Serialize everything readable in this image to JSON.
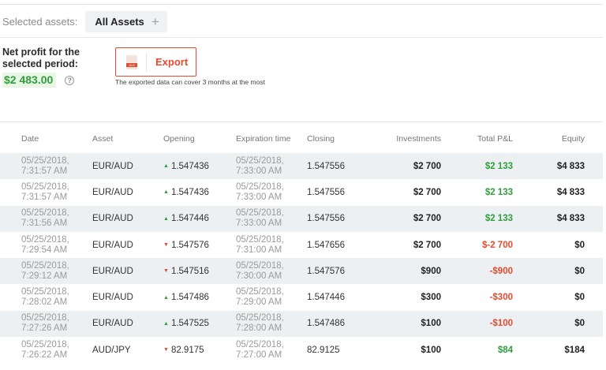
{
  "filter": {
    "label": "Selected assets:",
    "chip_label": "All Assets",
    "chip_plus": "+"
  },
  "profit": {
    "label": "Net profit for the selected period:",
    "value": "$2 483.00",
    "info_glyph": "?"
  },
  "export": {
    "label": "Export",
    "icon_text": "XLS",
    "note": "The exported data can cover 3 months at the most"
  },
  "colors": {
    "positive": "#2f9e3c",
    "negative": "#e44a2d",
    "accent": "#e44a2d"
  },
  "table": {
    "headers": {
      "date": "Date",
      "asset": "Asset",
      "opening": "Opening",
      "expiration": "Expiration time",
      "closing": "Closing",
      "investments": "Investments",
      "pnl": "Total P&L",
      "equity": "Equity"
    },
    "rows": [
      {
        "date": "05/25/2018,\n7:31:57 AM",
        "asset": "EUR/AUD",
        "dir": "up",
        "opening": "1.547436",
        "expiration": "05/25/2018,\n7:33:00 AM",
        "closing": "1.547556",
        "investments": "$2 700",
        "pnl": "$2 133",
        "pnl_sign": "pos",
        "equity": "$4 833"
      },
      {
        "date": "05/25/2018,\n7:31:57 AM",
        "asset": "EUR/AUD",
        "dir": "up",
        "opening": "1.547436",
        "expiration": "05/25/2018,\n7:33:00 AM",
        "closing": "1.547556",
        "investments": "$2 700",
        "pnl": "$2 133",
        "pnl_sign": "pos",
        "equity": "$4 833"
      },
      {
        "date": "05/25/2018,\n7:31:56 AM",
        "asset": "EUR/AUD",
        "dir": "up",
        "opening": "1.547446",
        "expiration": "05/25/2018,\n7:33:00 AM",
        "closing": "1.547556",
        "investments": "$2 700",
        "pnl": "$2 133",
        "pnl_sign": "pos",
        "equity": "$4 833"
      },
      {
        "date": "05/25/2018,\n7:29:54 AM",
        "asset": "EUR/AUD",
        "dir": "down",
        "opening": "1.547576",
        "expiration": "05/25/2018,\n7:31:00 AM",
        "closing": "1.547656",
        "investments": "$2 700",
        "pnl": "$-2 700",
        "pnl_sign": "neg",
        "equity": "$0"
      },
      {
        "date": "05/25/2018,\n7:29:12 AM",
        "asset": "EUR/AUD",
        "dir": "down",
        "opening": "1.547516",
        "expiration": "05/25/2018,\n7:30:00 AM",
        "closing": "1.547576",
        "investments": "$900",
        "pnl": "-$900",
        "pnl_sign": "neg",
        "equity": "$0"
      },
      {
        "date": "05/25/2018,\n7:28:02 AM",
        "asset": "EUR/AUD",
        "dir": "up",
        "opening": "1.547486",
        "expiration": "05/25/2018,\n7:29:00 AM",
        "closing": "1.547446",
        "investments": "$300",
        "pnl": "-$300",
        "pnl_sign": "neg",
        "equity": "$0"
      },
      {
        "date": "05/25/2018,\n7:27:26 AM",
        "asset": "EUR/AUD",
        "dir": "up",
        "opening": "1.547525",
        "expiration": "05/25/2018,\n7:28:00 AM",
        "closing": "1.547486",
        "investments": "$100",
        "pnl": "-$100",
        "pnl_sign": "neg",
        "equity": "$0"
      },
      {
        "date": "05/25/2018,\n7:26:22 AM",
        "asset": "AUD/JPY",
        "dir": "down",
        "opening": "82.9175",
        "expiration": "05/25/2018,\n7:27:00 AM",
        "closing": "82.9125",
        "investments": "$100",
        "pnl": "$84",
        "pnl_sign": "pos",
        "equity": "$184"
      }
    ]
  }
}
